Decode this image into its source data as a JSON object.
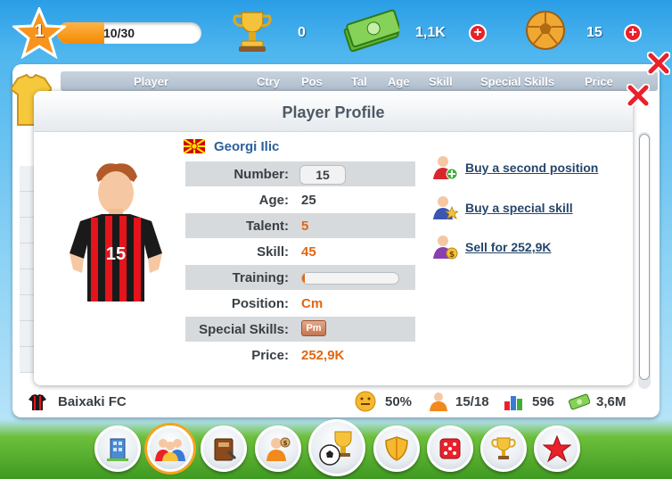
{
  "hud": {
    "level": "1",
    "xp_text": "10/30",
    "xp_fraction": 0.33,
    "trophies": "0",
    "money": "1,1K",
    "balls": "15",
    "icons": {
      "level": "star-icon",
      "trophies": "trophy-icon",
      "money": "cash-icon",
      "balls": "football-icon",
      "add": "plus-icon"
    }
  },
  "table_header": {
    "columns": [
      "Player",
      "Ctry",
      "Pos",
      "Tal",
      "Age",
      "Skill",
      "Special Skills",
      "Price"
    ]
  },
  "profile": {
    "title": "Player Profile",
    "player_name": "Georgi Ilic",
    "shirt_number": "15",
    "rows": {
      "number_label": "Number:",
      "number_value": "15",
      "age_label": "Age:",
      "age_value": "25",
      "talent_label": "Talent:",
      "talent_value": "5",
      "skill_label": "Skill:",
      "skill_value": "45",
      "training_label": "Training:",
      "training_fraction": 0.02,
      "position_label": "Position:",
      "position_value": "Cm",
      "special_label": "Special Skills:",
      "special_value": "Pm",
      "price_label": "Price:",
      "price_value": "252,9K"
    },
    "actions": {
      "second_position": "Buy a second position",
      "special_skill": "Buy a special skill",
      "sell": "Sell for 252,9K"
    }
  },
  "footer": {
    "club_name": "Baixaki FC",
    "happiness": "50%",
    "players": "15/18",
    "rating": "596",
    "funds": "3,6M"
  },
  "colors": {
    "accent_orange": "#e26611",
    "link_blue": "#25466b",
    "close_red": "#e8212a"
  },
  "nav": {
    "icons": [
      "building-icon",
      "team-icon",
      "book-icon",
      "manager-icon",
      "match-icon",
      "shield-icon",
      "dice-icon",
      "trophy-icon",
      "star-icon"
    ],
    "active": "team-icon"
  }
}
